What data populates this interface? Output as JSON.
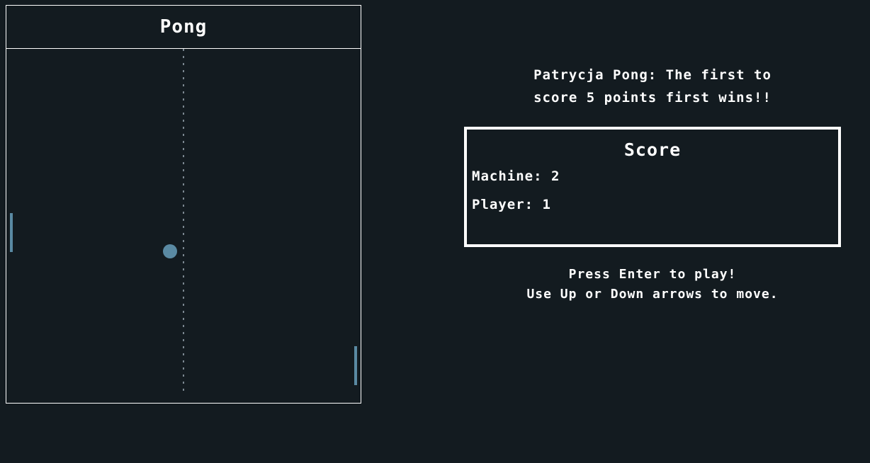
{
  "game": {
    "title": "Pong"
  },
  "info": {
    "headline": "Patrycja Pong: The first to\nscore 5 points first wins!!"
  },
  "score": {
    "title": "Score",
    "machine": "Machine: 2",
    "player": "Player: 1"
  },
  "help": {
    "line1": "Press Enter to play!",
    "line2": "Use Up or Down arrows to move."
  }
}
